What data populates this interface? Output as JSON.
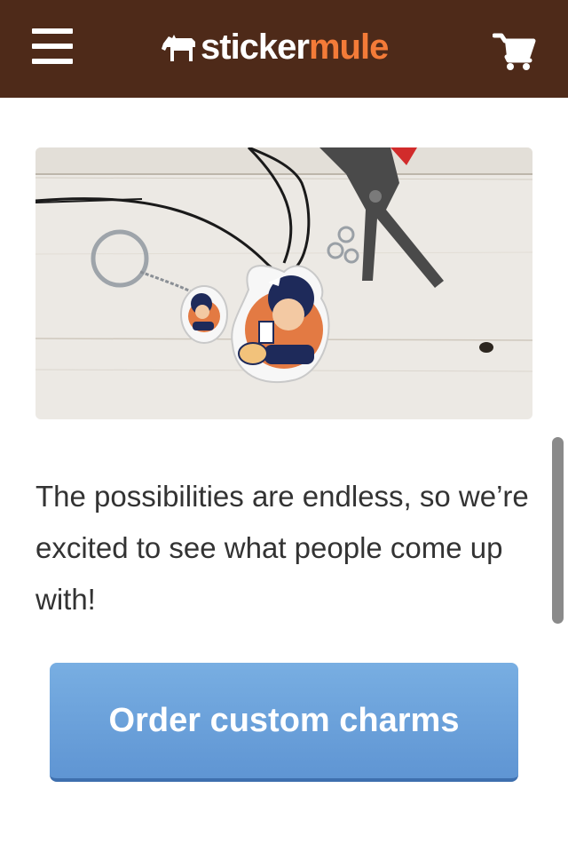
{
  "header": {
    "menu_icon": "hamburger-menu-icon",
    "logo": {
      "word1": "sticker",
      "word2": "mule",
      "icon": "mule-icon"
    },
    "cart_icon": "shopping-cart-icon"
  },
  "colors": {
    "header_bg": "#4e2a19",
    "logo_accent": "#f47b38",
    "cta_bg": "#6ea3dc"
  },
  "content": {
    "image_alt": "Acrylic charms on keychain and necklace",
    "paragraph": "The possibilities are endless, so we’re excited to see what people come up with!",
    "cta_label": "Order custom charms"
  }
}
